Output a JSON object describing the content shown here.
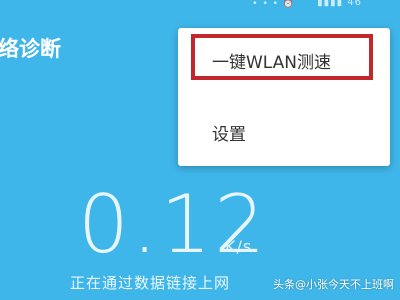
{
  "status_bar": {
    "signal_text": "46",
    "icons": [
      "notification-dots-icon",
      "alarm-icon",
      "signal-icon"
    ]
  },
  "header": {
    "title": "络诊断"
  },
  "speed": {
    "value": "0.12",
    "unit": "K/s",
    "status": "正在通过数据链接上网"
  },
  "menu": {
    "items": [
      {
        "label": "一键WLAN测速",
        "highlighted": true
      },
      {
        "label": "设置"
      }
    ]
  },
  "watermark": {
    "text": "头条@小张今天不上班啊"
  },
  "colors": {
    "background": "#3fb6ea",
    "highlight_border": "#c0282b",
    "menu_bg": "#ffffff"
  }
}
